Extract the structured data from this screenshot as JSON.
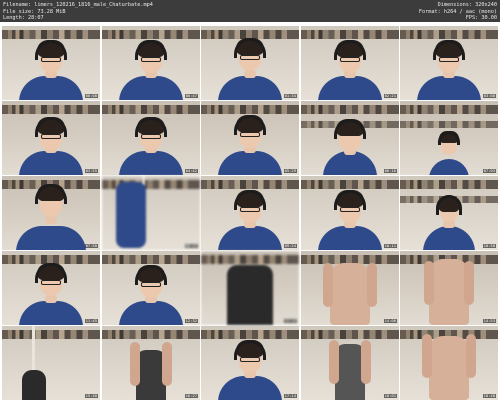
{
  "header": {
    "filename": "Filename: limers_120216_1816_male_Chaturbate.mp4",
    "filesize": "File size: 73.28 MiB",
    "length": "Length: 28:07",
    "dimensions": "Dimensions: 320x240",
    "format": "Format: h264 / aac (mono)",
    "fps": "FPS: 30.00"
  },
  "thumbnails": [
    {
      "time": "00:00"
    },
    {
      "time": "00:47"
    },
    {
      "time": "01:34"
    },
    {
      "time": "02:21"
    },
    {
      "time": "03:08"
    },
    {
      "time": "03:55"
    },
    {
      "time": "04:42"
    },
    {
      "time": "05:29"
    },
    {
      "time": "06:16"
    },
    {
      "time": "07:03"
    },
    {
      "time": "07:50"
    },
    {
      "time": "08:37"
    },
    {
      "time": "09:24"
    },
    {
      "time": "10:11"
    },
    {
      "time": "10:58"
    },
    {
      "time": "11:45"
    },
    {
      "time": "12:32"
    },
    {
      "time": "13:19"
    },
    {
      "time": "14:06"
    },
    {
      "time": "14:53"
    },
    {
      "time": "15:40"
    },
    {
      "time": "16:27"
    },
    {
      "time": "17:14"
    },
    {
      "time": "18:01"
    },
    {
      "time": "18:48"
    }
  ]
}
